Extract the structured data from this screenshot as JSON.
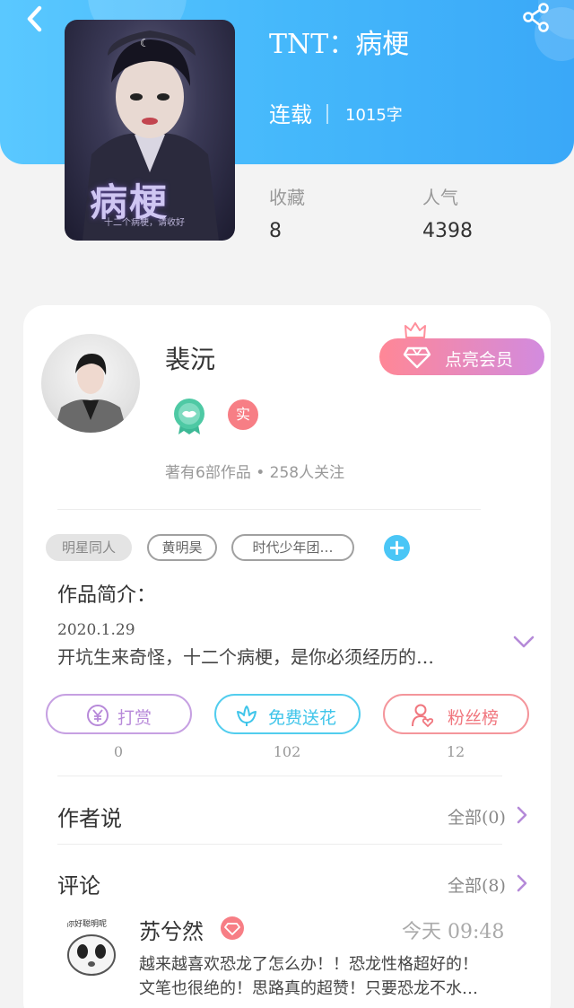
{
  "book": {
    "title": "TNT：病梗",
    "status": "连载",
    "word_count": "1015字",
    "cover_title": "病梗",
    "cover_subtitle": "十二个病梗，请收好",
    "stats": [
      {
        "label": "收藏",
        "value": "8"
      },
      {
        "label": "人气",
        "value": "4398"
      }
    ]
  },
  "author": {
    "name": "裴沅",
    "member_button": "点亮会员",
    "badge_real": "实",
    "meta": "著有6部作品 • 258人关注"
  },
  "tags": [
    "明星同人",
    "黄明昊",
    "时代少年团…"
  ],
  "intro": {
    "label": "作品简介：",
    "date": "2020.1.29",
    "text": "开坑生来奇怪，十二个病梗，是你必须经历的…"
  },
  "actions": [
    {
      "label": "打赏",
      "count": "0",
      "icon": "yen-coin-icon",
      "color": "#b789d9"
    },
    {
      "label": "免费送花",
      "count": "102",
      "icon": "flower-icon",
      "color": "#3fc5ea"
    },
    {
      "label": "粉丝榜",
      "count": "12",
      "icon": "fan-user-icon",
      "color": "#f0767e"
    }
  ],
  "author_says": {
    "title": "作者说",
    "all": "全部(0)"
  },
  "comments_section": {
    "title": "评论",
    "all": "全部(8)"
  },
  "comment": {
    "avatar_caption": "你好聪明呢",
    "name": "苏兮然",
    "time": "今天 09:48",
    "line1": "越来越喜欢恐龙了怎么办！！恐龙性格超好的！",
    "line2": "文笔也很绝的！思路真的超赞！只要恐龙不水…"
  },
  "colors": {
    "header_blue": "#45b8fb",
    "accent_cyan": "#4ac6f6",
    "member_pink": "#ff8796",
    "member_purple": "#d28bdf",
    "badge_green": "#4ec9a4"
  }
}
